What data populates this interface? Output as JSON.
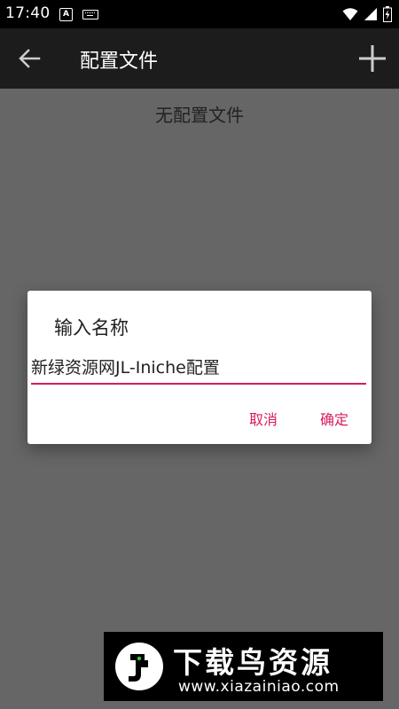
{
  "status_bar": {
    "time": "17:40",
    "a_badge": "A",
    "icons": [
      "a-notification-icon",
      "keyboard-icon",
      "wifi-icon",
      "signal-icon",
      "battery-icon"
    ]
  },
  "app_bar": {
    "title": "配置文件",
    "back_icon": "arrow-left-icon",
    "add_icon": "plus-icon"
  },
  "main": {
    "empty_text": "无配置文件"
  },
  "dialog": {
    "title": "输入名称",
    "input_value": "新绿资源网JL-Iniche配置",
    "cancel_label": "取消",
    "ok_label": "确定",
    "accent_color": "#d81b60"
  },
  "watermark": {
    "title": "下载鸟资源",
    "url": "www.xiazainiao.com"
  }
}
